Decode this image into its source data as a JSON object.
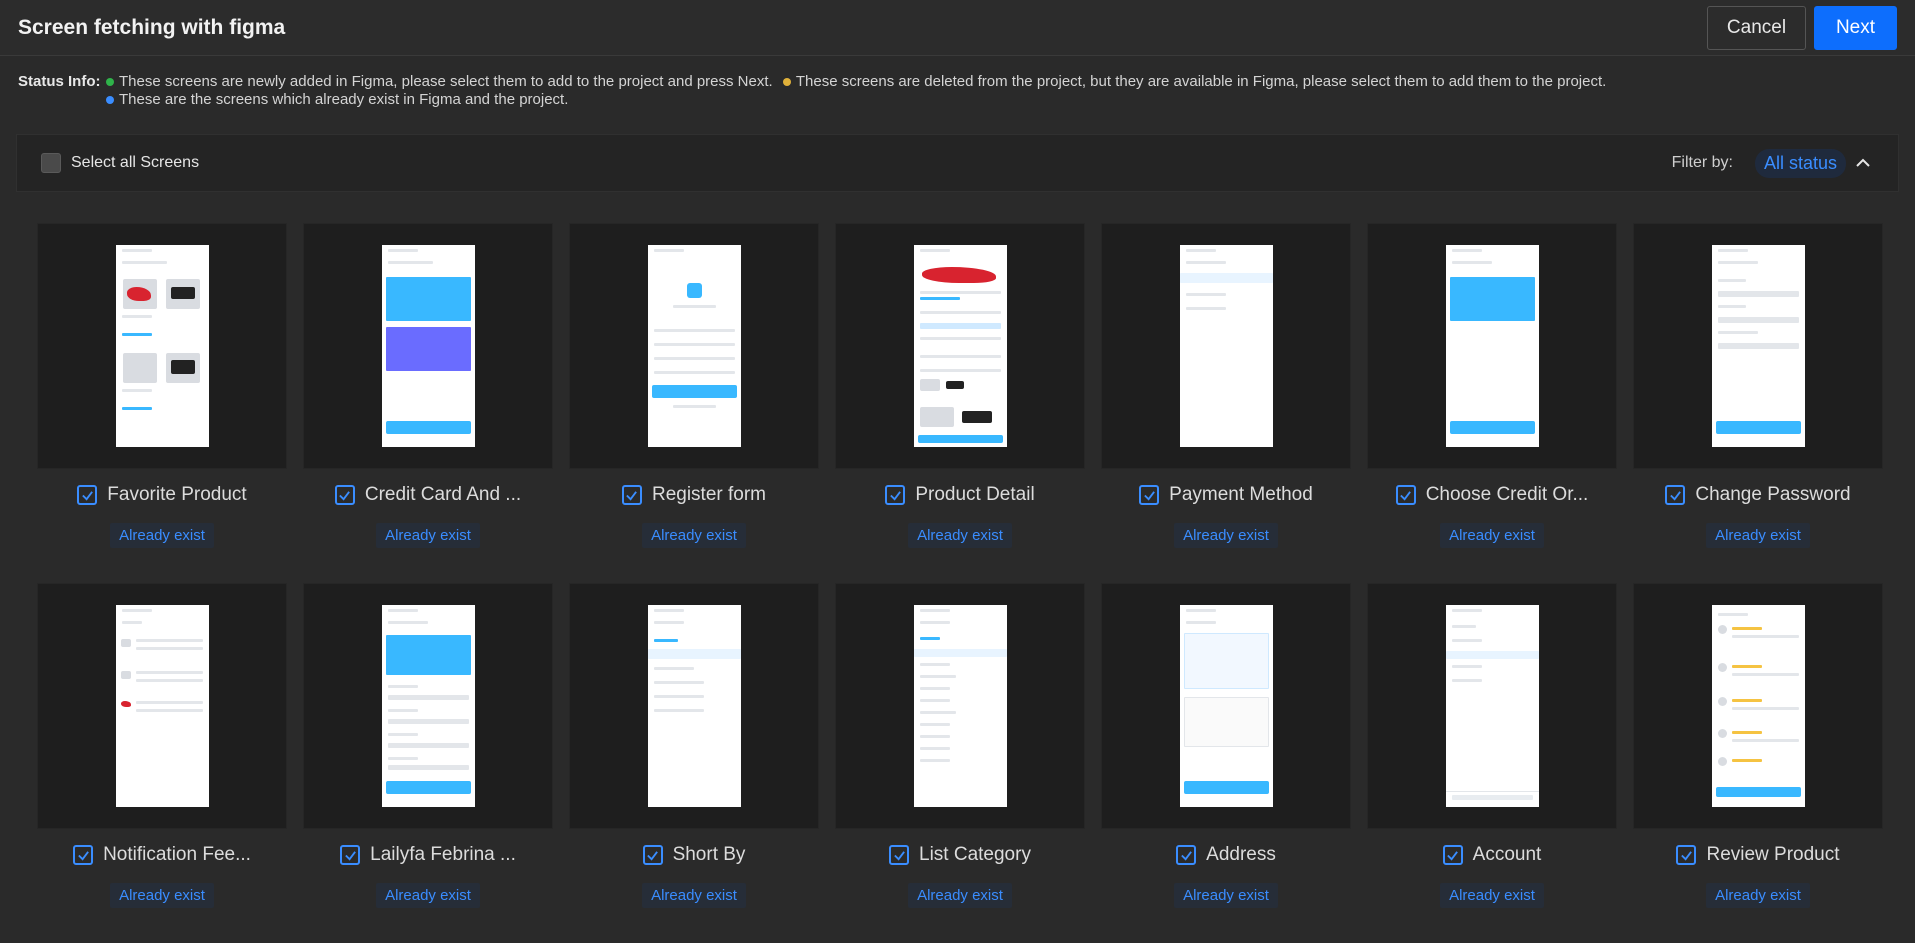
{
  "header": {
    "title": "Screen fetching with figma",
    "cancel_label": "Cancel",
    "next_label": "Next"
  },
  "status": {
    "label": "Status Info:",
    "green_text": "These screens are newly added in Figma, please select them to add to the project and press Next.",
    "yellow_text": "These screens are deleted from the project, but they are available in Figma, please select them to add them to the project.",
    "blue_text": "These are the screens which already exist in Figma and the project.",
    "colors": {
      "green": "#2fb34a",
      "yellow": "#e0b13a",
      "blue": "#3a8dff"
    }
  },
  "toolbar": {
    "select_all_label": "Select all Screens",
    "filter_label": "Filter by:",
    "filter_value": "All status"
  },
  "screens": [
    {
      "name": "Favorite Product",
      "status": "Already exist"
    },
    {
      "name": "Credit Card And ...",
      "status": "Already exist"
    },
    {
      "name": "Register form",
      "status": "Already exist"
    },
    {
      "name": "Product Detail",
      "status": "Already exist"
    },
    {
      "name": "Payment Method",
      "status": "Already exist"
    },
    {
      "name": "Choose Credit Or...",
      "status": "Already exist"
    },
    {
      "name": "Change Password",
      "status": "Already exist"
    },
    {
      "name": "Notification Fee...",
      "status": "Already exist"
    },
    {
      "name": "Lailyfa Febrina ...",
      "status": "Already exist"
    },
    {
      "name": "Short By",
      "status": "Already exist"
    },
    {
      "name": "List Category",
      "status": "Already exist"
    },
    {
      "name": "Address",
      "status": "Already exist"
    },
    {
      "name": "Account",
      "status": "Already exist"
    },
    {
      "name": "Review Product",
      "status": "Already exist"
    }
  ]
}
